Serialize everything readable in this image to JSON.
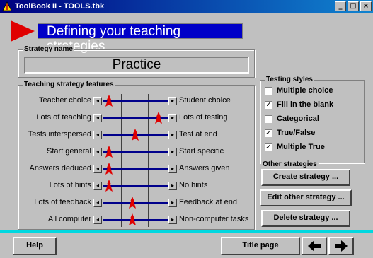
{
  "window": {
    "title": "ToolBook II - TOOLS.tbk",
    "minimize": "_",
    "maximize": "□",
    "close": "×"
  },
  "header": {
    "title": "Defining your teaching strategies"
  },
  "strategy_name": {
    "legend": "Strategy name",
    "value": "Practice"
  },
  "features": {
    "legend": "Teaching strategy features",
    "rows": [
      {
        "left": "Teacher choice",
        "right": "Student choice",
        "level": 0.05
      },
      {
        "left": "Lots of teaching",
        "right": "Lots of testing",
        "level": 0.9
      },
      {
        "left": "Tests interspersed",
        "right": "Test at end",
        "level": 0.5
      },
      {
        "left": "Start general",
        "right": "Start specific",
        "level": 0.05
      },
      {
        "left": "Answers deduced",
        "right": "Answers given",
        "level": 0.05
      },
      {
        "left": "Lots of hints",
        "right": "No hints",
        "level": 0.05
      },
      {
        "left": "Lots of feedback",
        "right": "Feedback at end",
        "level": 0.45
      },
      {
        "left": "All computer",
        "right": "Non-computer tasks",
        "level": 0.45
      }
    ]
  },
  "testing_styles": {
    "legend": "Testing styles",
    "items": [
      {
        "label": "Multiple choice",
        "checked": false
      },
      {
        "label": "Fill in the blank",
        "checked": true
      },
      {
        "label": "Categorical",
        "checked": false
      },
      {
        "label": "True/False",
        "checked": true
      },
      {
        "label": "Multiple True",
        "checked": true
      }
    ]
  },
  "other_strategies": {
    "legend": "Other strategies",
    "create": "Create strategy ...",
    "edit": "Edit other strategy ...",
    "delete": "Delete strategy ..."
  },
  "footer": {
    "help": "Help",
    "title_page": "Title page"
  },
  "colors": {
    "header_bg": "#0000c8",
    "marker": "#e00000",
    "thumb": "#e00000",
    "track": "#00008b",
    "accent_line": "#00d8e0"
  }
}
